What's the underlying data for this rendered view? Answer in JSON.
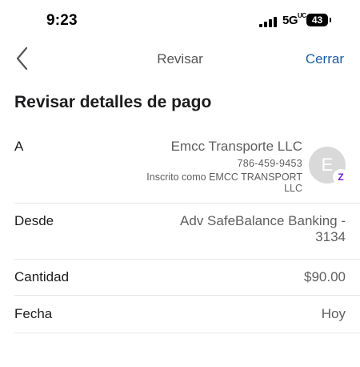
{
  "status_bar": {
    "time": "9:23",
    "network": "5G",
    "network_suffix": "UC",
    "battery_level": "43"
  },
  "nav": {
    "back_icon": "chevron-left-icon",
    "title": "Revisar",
    "close_label": "Cerrar"
  },
  "page_title": "Revisar detalles de pago",
  "recipient": {
    "label": "A",
    "name": "Emcc Transporte LLC",
    "phone": "786-459-9453",
    "enrolled_as": "Inscrito como EMCC TRANSPORT LLC",
    "avatar_initial": "E",
    "badge_glyph": "Z"
  },
  "from": {
    "label": "Desde",
    "value": "Adv SafeBalance Banking - 3134"
  },
  "amount": {
    "label": "Cantidad",
    "value": "$90.00"
  },
  "date": {
    "label": "Fecha",
    "value": "Hoy"
  },
  "colors": {
    "accent": "#1b5ea8",
    "zelle": "#6d1ed4",
    "avatar_bg": "#d9d9d9"
  }
}
